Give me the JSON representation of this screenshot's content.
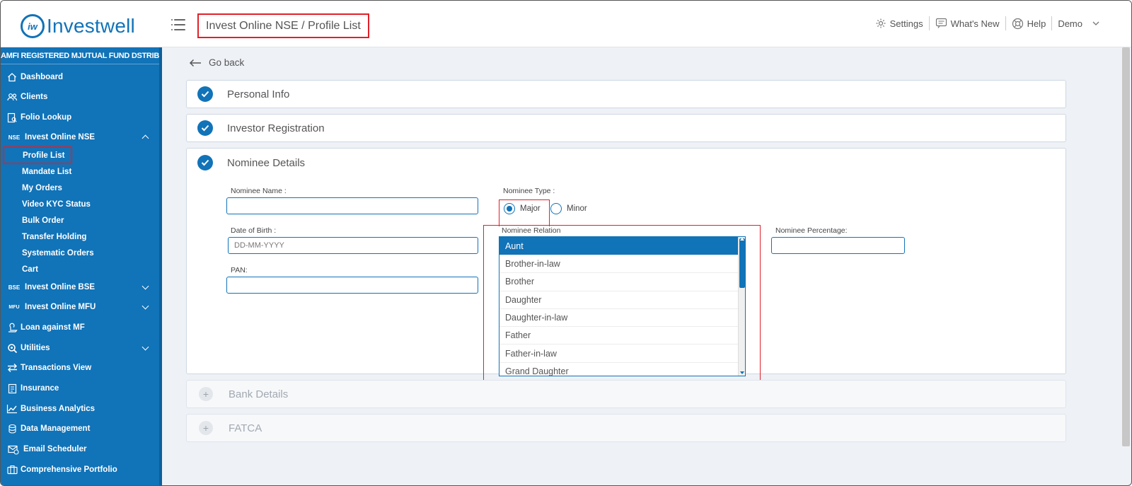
{
  "app": {
    "logo_mark": "iw",
    "logo_text": "Investwell",
    "breadcrumb_title": "Invest Online NSE / Profile List"
  },
  "topbar": {
    "settings": "Settings",
    "whats_new": "What's New",
    "help": "Help",
    "user": "Demo"
  },
  "sidebar": {
    "header": "AMFI REGISTERED MJUTUAL FUND DSTRIBUTOR",
    "items": [
      {
        "label": "Dashboard",
        "icon": "home-icon"
      },
      {
        "label": "Clients",
        "icon": "users-icon"
      },
      {
        "label": "Folio Lookup",
        "icon": "folio-icon"
      },
      {
        "label": "Invest Online NSE",
        "icon_text": "NSE"
      },
      {
        "label": "Invest Online BSE",
        "icon_text": "BSE"
      },
      {
        "label": "Invest Online MFU",
        "icon_text": "MFU"
      },
      {
        "label": "Loan against MF",
        "icon": "loan-icon"
      },
      {
        "label": "Utilities",
        "icon": "utilities-icon"
      },
      {
        "label": "Transactions View",
        "icon": "transfer-arrows-icon"
      },
      {
        "label": "Insurance",
        "icon": "insurance-icon"
      },
      {
        "label": "Business Analytics",
        "icon": "analytics-icon"
      },
      {
        "label": "Data Management",
        "icon": "data-icon"
      },
      {
        "label": "Email Scheduler",
        "icon": "email-icon"
      },
      {
        "label": "Comprehensive Portfolio",
        "icon": "portfolio-icon"
      }
    ],
    "nse_sub": [
      "Profile List",
      "Mandate List",
      "My Orders",
      "Video KYC Status",
      "Bulk Order",
      "Transfer Holding",
      "Systematic Orders",
      "Cart"
    ]
  },
  "main": {
    "go_back": "Go back",
    "panels": {
      "personal_info": "Personal Info",
      "investor_registration": "Investor Registration",
      "nominee_details": "Nominee Details",
      "bank_details": "Bank Details",
      "fatca": "FATCA"
    },
    "nominee": {
      "name_label": "Nominee Name :",
      "name_value": "",
      "type_label": "Nominee Type :",
      "type_options": [
        "Major",
        "Minor"
      ],
      "type_selected": "Major",
      "dob_label": "Date of Birth :",
      "dob_placeholder": "DD-MM-YYYY",
      "pan_label": "PAN:",
      "pan_value": "",
      "relation_label": "Nominee Relation",
      "relation_options": [
        "Aunt",
        "Brother-in-law",
        "Brother",
        "Daughter",
        "Daughter-in-law",
        "Father",
        "Father-in-law",
        "Grand Daughter"
      ],
      "relation_selected": "Aunt",
      "percentage_label": "Nominee Percentage:",
      "percentage_value": ""
    }
  },
  "colors": {
    "brand": "#1173b8",
    "highlight": "#e0212a"
  }
}
